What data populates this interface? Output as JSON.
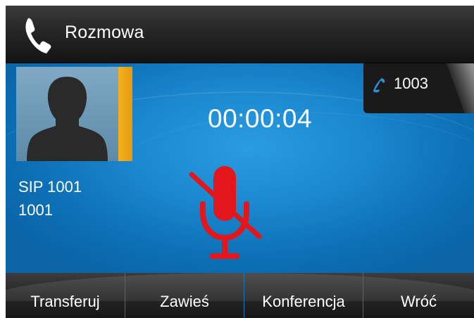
{
  "header": {
    "title": "Rozmowa",
    "icon": "handset-icon"
  },
  "call": {
    "caller_name": "SIP 1001",
    "caller_number": "1001",
    "duration": "00:00:04",
    "muted": true
  },
  "line": {
    "number": "1003",
    "icon": "phone-icon"
  },
  "softkeys": [
    {
      "label": "Transferuj"
    },
    {
      "label": "Zawieś"
    },
    {
      "label": "Konferencja"
    },
    {
      "label": "Wróć"
    }
  ],
  "colors": {
    "background_blue": "#1b88cf",
    "avatar_tab": "#f2b01e",
    "mute_red": "#e3171b",
    "line_icon": "#2b8fd8"
  }
}
